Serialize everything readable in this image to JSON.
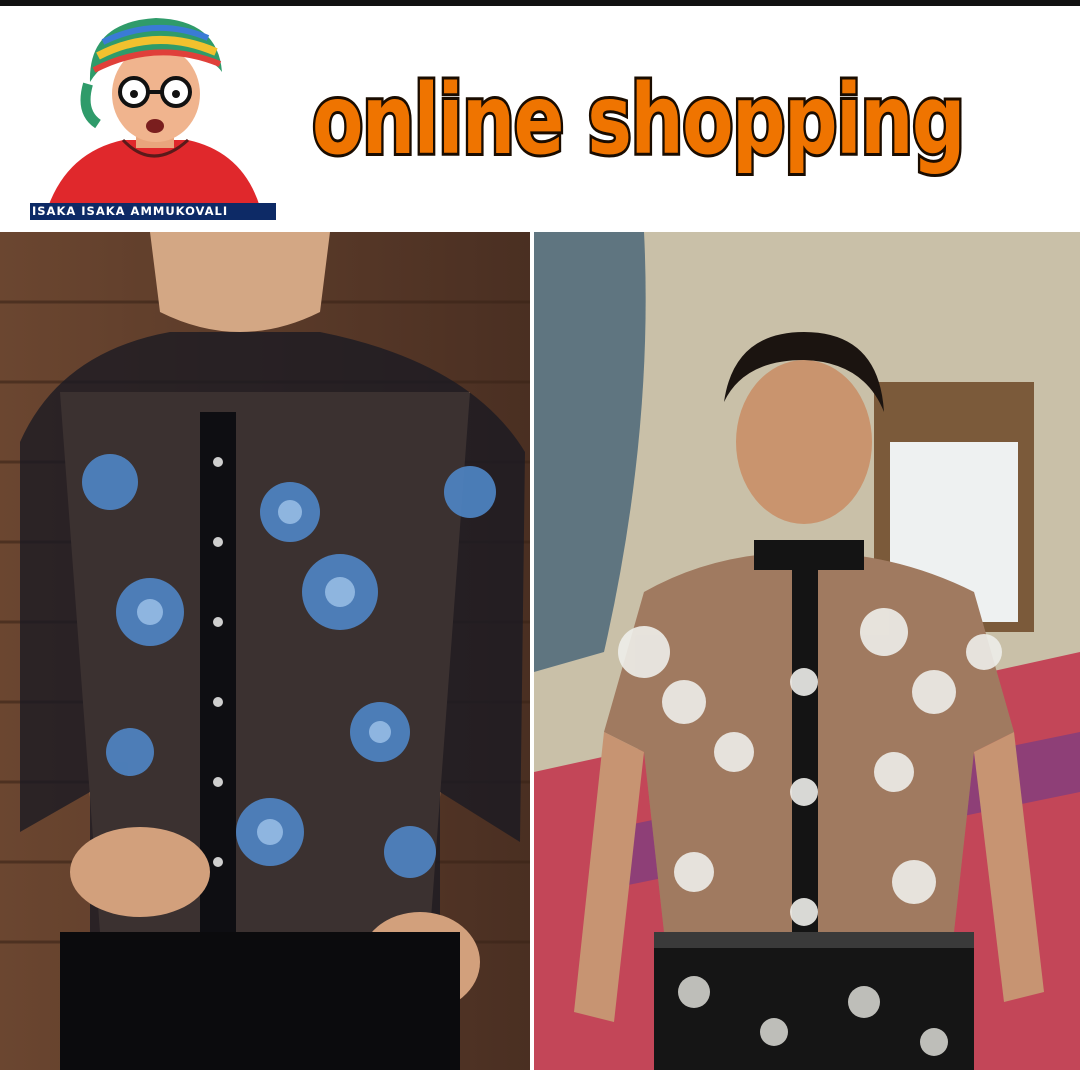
{
  "header": {
    "headline": "online shopping",
    "logo_caption": "ISAKA ISAKA AMMUKOVALI"
  },
  "colors": {
    "headline_fill": "#ef7400",
    "headline_outline": "#1a0c00",
    "caption_bg": "#0d2a66"
  },
  "images": {
    "left_photo": "model-in-blue-floral-sheer-shirt",
    "right_photo": "man-in-white-floral-sheer-shirt"
  }
}
